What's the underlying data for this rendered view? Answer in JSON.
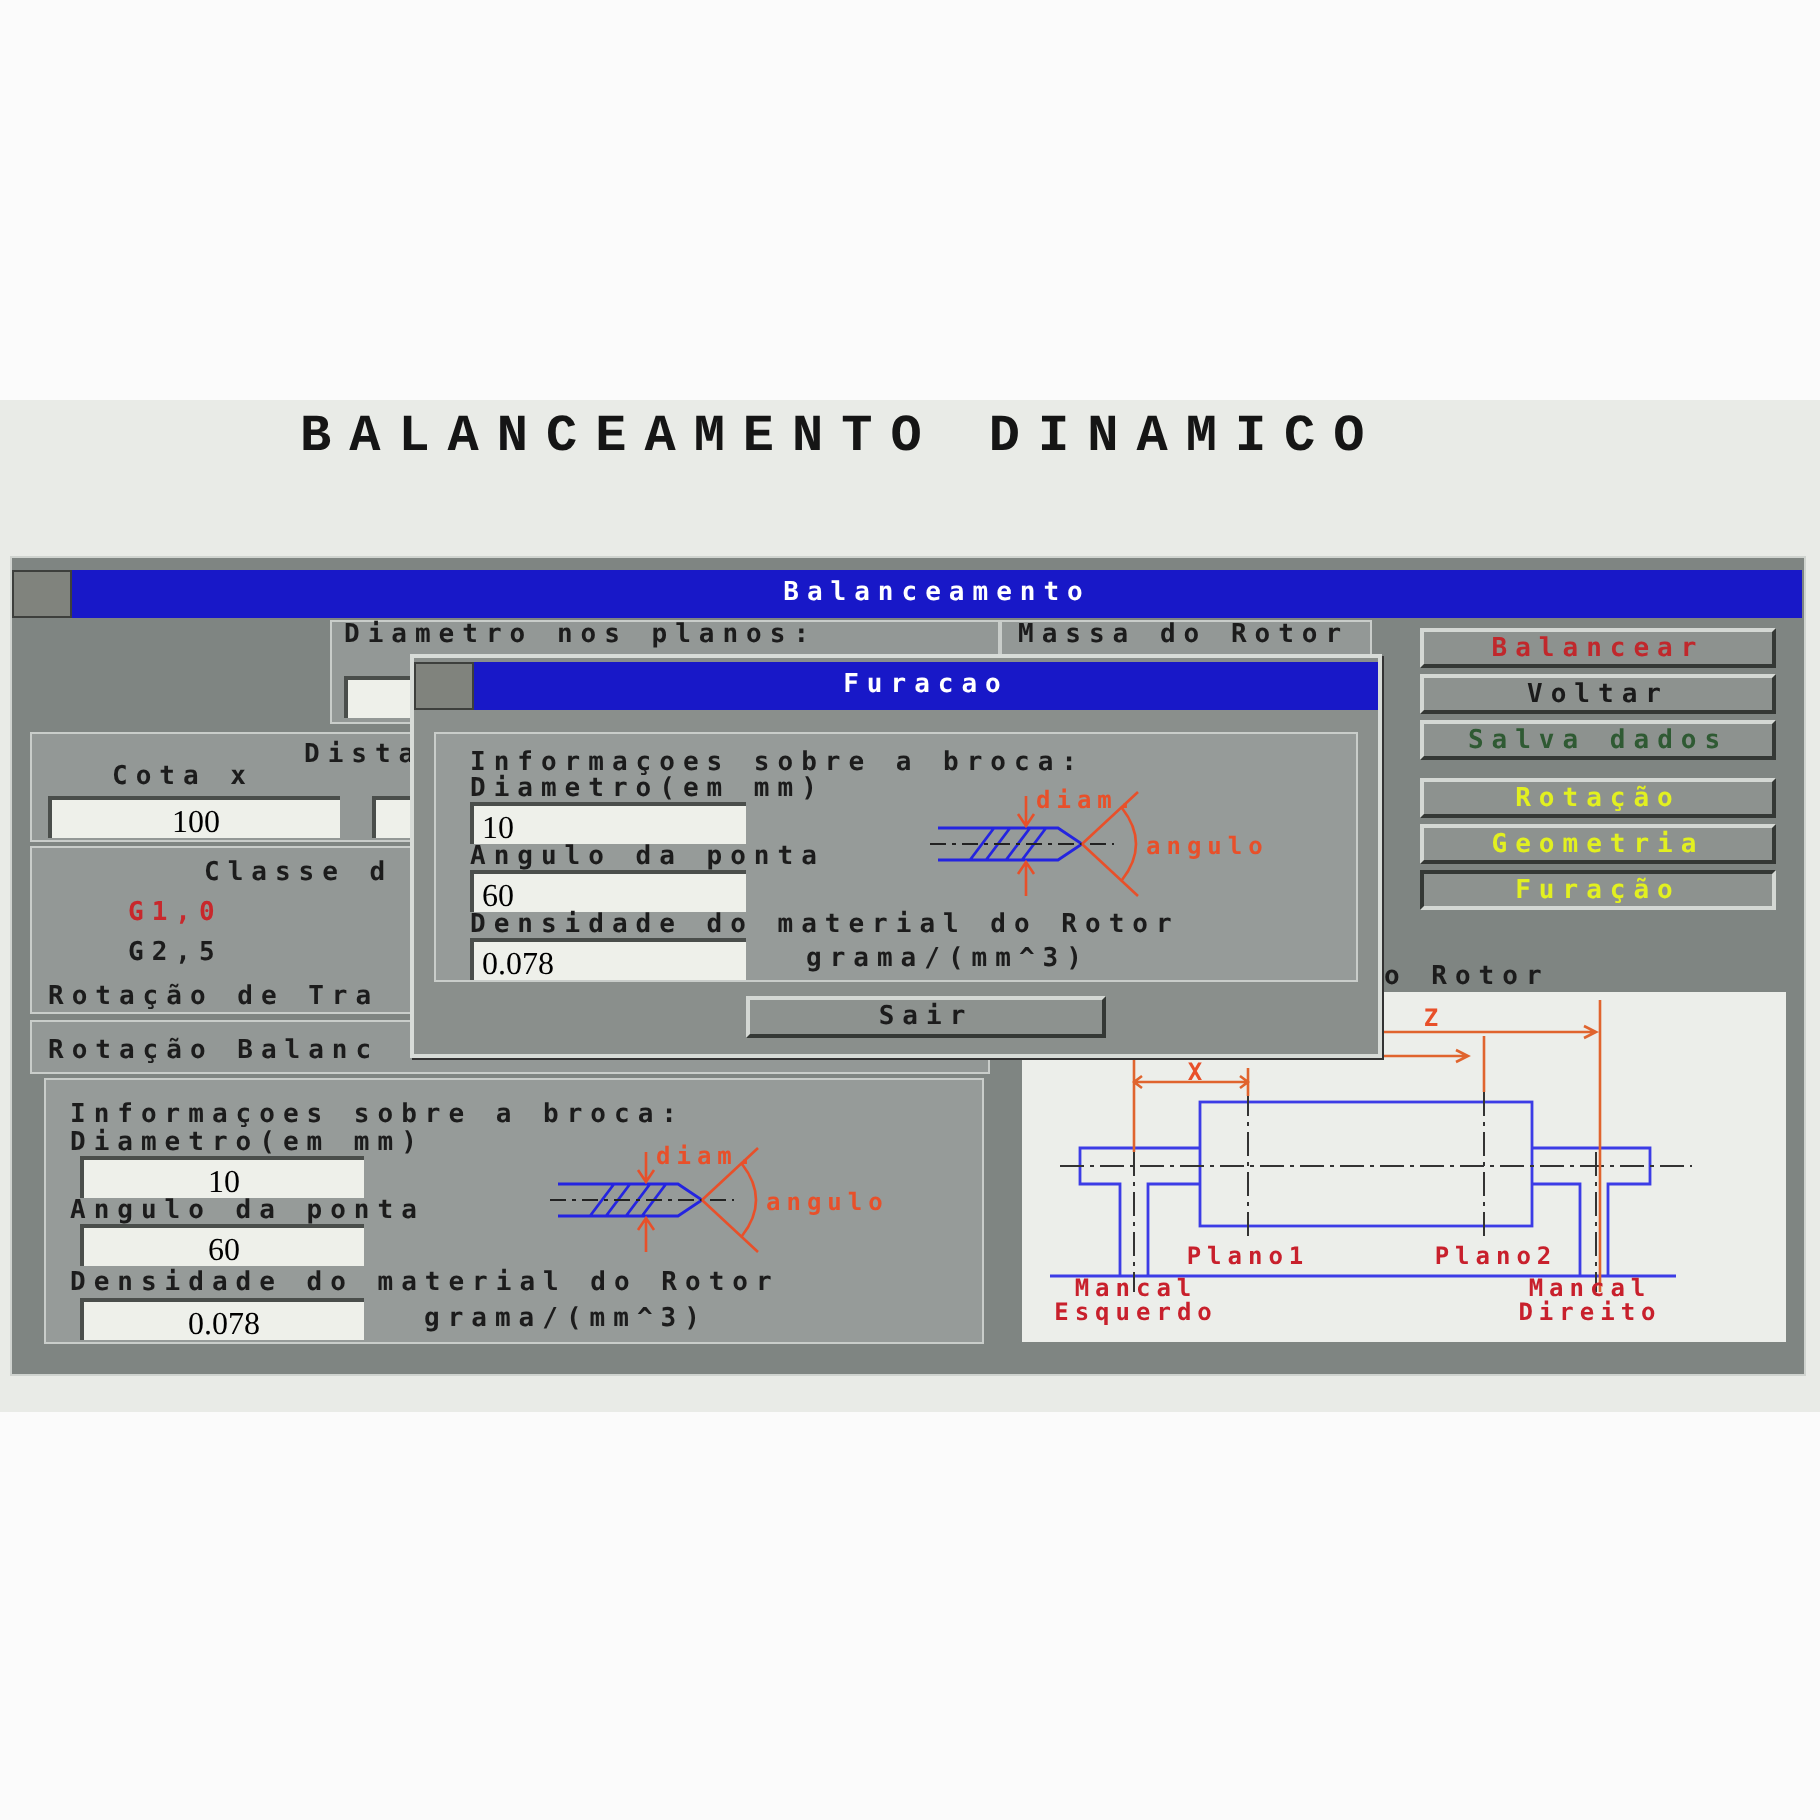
{
  "screen_title": "BALANCEAMENTO DINAMICO",
  "window": {
    "title": "Balanceamento"
  },
  "diameter_box": {
    "label": "Diametro nos planos:"
  },
  "mass_box": {
    "label": "Massa do Rotor"
  },
  "distance_box": {
    "label": "Dista",
    "field_label": "Cota x",
    "value": "100"
  },
  "class_box": {
    "label": "Classe d",
    "options": [
      {
        "label": "G1,0",
        "selected": true
      },
      {
        "label": "G2,5",
        "selected": false
      }
    ],
    "footer": "Rotação de Tra"
  },
  "balance_rotation": {
    "label": "Rotação Balanc"
  },
  "drill_panel": {
    "heading": "Informaçoes sobre a broca:",
    "fields": [
      {
        "label": "Diametro(em mm)",
        "value": "10"
      },
      {
        "label": "Angulo da ponta",
        "value": "60"
      },
      {
        "label": "Densidade do material do Rotor",
        "value": "0.078"
      }
    ],
    "unit": "grama/(mm^3)",
    "diameter_label": "diam.",
    "angle_label": "angulo"
  },
  "buttons": [
    {
      "label": "Balancear",
      "color": "#c0282c",
      "selected": false
    },
    {
      "label": "Voltar",
      "color": "#1a1a1a",
      "selected": false
    },
    {
      "label": "Salva dados",
      "color": "#2f5a33",
      "selected": false
    },
    {
      "label": "Rotação",
      "color": "#e2f020",
      "selected": false
    },
    {
      "label": "Geometria",
      "color": "#e2f020",
      "selected": false
    },
    {
      "label": "Furação",
      "color": "#e2f020",
      "selected": true
    }
  ],
  "rotor_diagram": {
    "title": "o Rotor",
    "z_label": "Z",
    "x_label": "X",
    "planes": [
      "Plano1",
      "Plano2"
    ],
    "bearings": [
      {
        "lines": [
          "Mancal",
          "Esquerdo"
        ]
      },
      {
        "lines": [
          "Mancal",
          "Direito"
        ]
      }
    ]
  },
  "dialog": {
    "title": "Furacao",
    "heading": "Informaçoes sobre a broca:",
    "fields": [
      {
        "label": "Diametro(em mm)",
        "value": "10"
      },
      {
        "label": "Angulo da ponta",
        "value": "60"
      },
      {
        "label": "Densidade do material do Rotor",
        "value": "0.078"
      }
    ],
    "unit": "grama/(mm^3)",
    "diameter_label": "diam.",
    "angle_label": "angulo",
    "button": "Sair"
  }
}
